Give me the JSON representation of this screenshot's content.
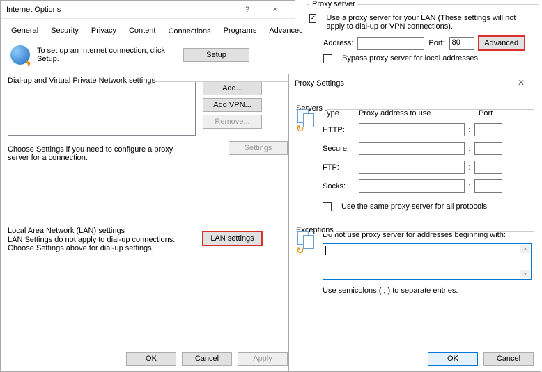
{
  "internet_options": {
    "title": "Internet Options",
    "help_glyph": "?",
    "close_glyph": "×",
    "tabs": [
      "General",
      "Security",
      "Privacy",
      "Content",
      "Connections",
      "Programs",
      "Advanced"
    ],
    "active_tab": "Connections",
    "setup_text": "To set up an Internet connection, click Setup.",
    "setup_btn": "Setup",
    "dialup_group": "Dial-up and Virtual Private Network settings",
    "add_btn": "Add...",
    "addvpn_btn": "Add VPN...",
    "remove_btn": "Remove...",
    "settings_btn": "Settings",
    "choose_settings_text": "Choose Settings if you need to configure a proxy server for a connection.",
    "lan_group": "Local Area Network (LAN) settings",
    "lan_hint": "LAN Settings do not apply to dial-up connections. Choose Settings above for dial-up settings.",
    "lan_btn": "LAN settings",
    "ok": "OK",
    "cancel": "Cancel",
    "apply": "Apply"
  },
  "proxy_panel": {
    "group": "Proxy server",
    "use_proxy_label": "Use a proxy server for your LAN (These settings will not apply to dial-up or VPN connections).",
    "use_proxy_checked": true,
    "address_label": "Address:",
    "address_value": "",
    "port_label": "Port:",
    "port_value": "80",
    "advanced_btn": "Advanced",
    "bypass_label": "Bypass proxy server for local addresses",
    "bypass_checked": false
  },
  "proxy_settings": {
    "title": "Proxy Settings",
    "close_glyph": "×",
    "servers_group": "Servers",
    "type_hdr": "Type",
    "addr_hdr": "Proxy address to use",
    "port_hdr": "Port",
    "rows": [
      {
        "label": "HTTP:",
        "addr": "",
        "port": ""
      },
      {
        "label": "Secure:",
        "addr": "",
        "port": ""
      },
      {
        "label": "FTP:",
        "addr": "",
        "port": ""
      },
      {
        "label": "Socks:",
        "addr": "",
        "port": ""
      }
    ],
    "same_proxy_label": "Use the same proxy server for all protocols",
    "same_proxy_checked": false,
    "exceptions_group": "Exceptions",
    "exceptions_hint": "Do not use proxy server for addresses beginning with:",
    "exceptions_value": "",
    "exceptions_note": "Use semicolons ( ; ) to separate entries.",
    "ok": "OK",
    "cancel": "Cancel"
  }
}
